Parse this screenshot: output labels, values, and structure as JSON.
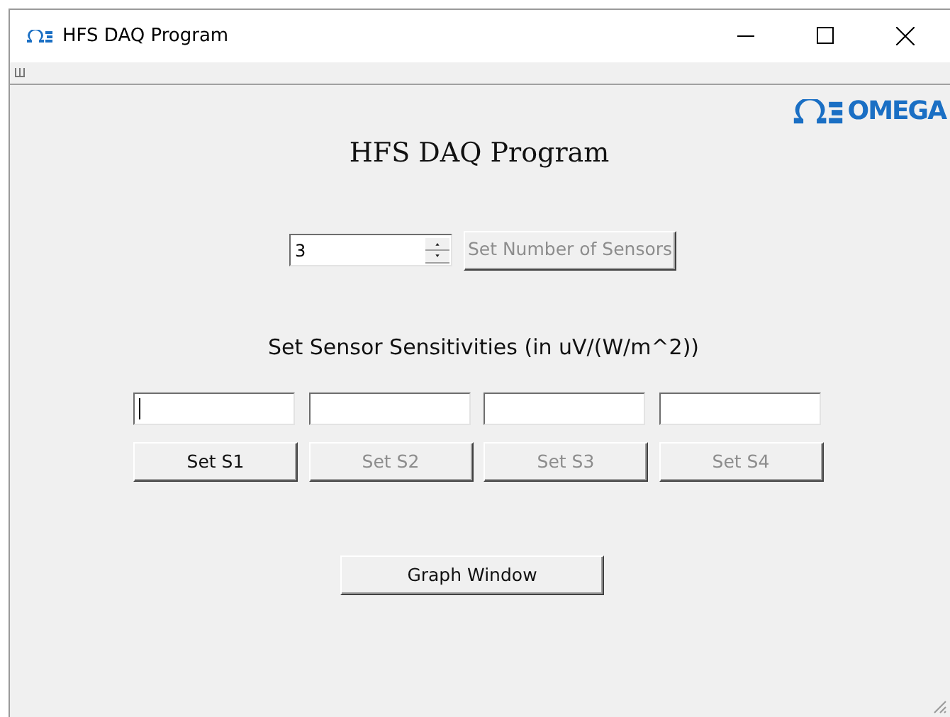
{
  "window": {
    "title": "HFS DAQ Program"
  },
  "logo": {
    "text": "OMEGA"
  },
  "heading": "HFS DAQ Program",
  "sensor_count": {
    "value": "3",
    "button": {
      "label": "Set Number of Sensors",
      "disabled": true
    }
  },
  "sensitivity_label": "Set Sensor Sensitivities (in uV/(W/m^2))",
  "sensors": [
    {
      "focused": true,
      "button": {
        "label": "Set S1",
        "disabled": false
      }
    },
    {
      "focused": false,
      "button": {
        "label": "Set S2",
        "disabled": true
      }
    },
    {
      "focused": false,
      "button": {
        "label": "Set S3",
        "disabled": true
      }
    },
    {
      "focused": false,
      "button": {
        "label": "Set S4",
        "disabled": true
      }
    }
  ],
  "graph_button": {
    "label": "Graph Window",
    "disabled": false
  }
}
